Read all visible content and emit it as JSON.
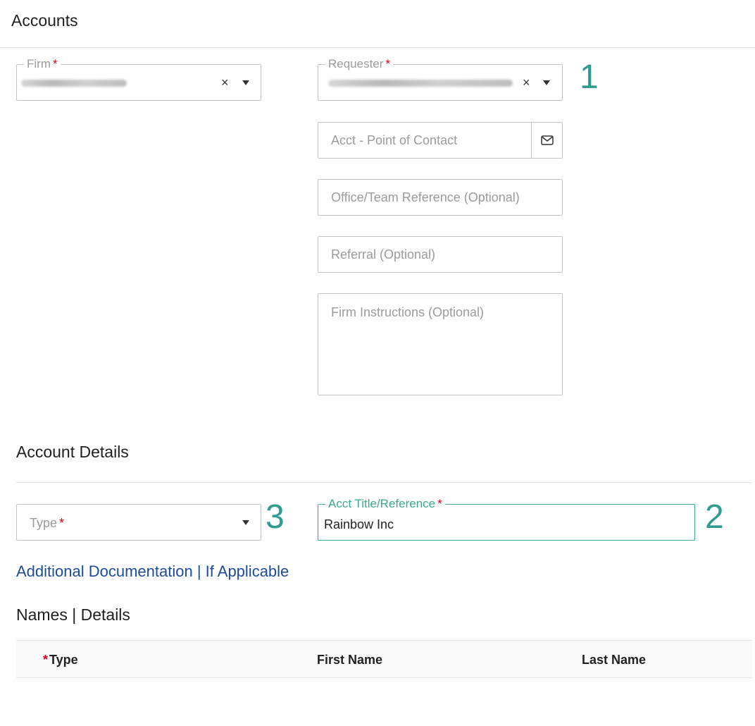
{
  "page": {
    "title": "Accounts"
  },
  "firm": {
    "label": "Firm",
    "required_mark": "*",
    "clear_glyph": "×"
  },
  "requester": {
    "label": "Requester",
    "required_mark": "*",
    "clear_glyph": "×"
  },
  "contact": {
    "placeholder": "Acct - Point of Contact",
    "icon": "envelope-icon"
  },
  "office": {
    "placeholder": "Office/Team Reference (Optional)"
  },
  "referral": {
    "placeholder": "Referral (Optional)"
  },
  "instructions": {
    "placeholder": "Firm Instructions (Optional)"
  },
  "account_details": {
    "title": "Account Details",
    "type": {
      "placeholder": "Type",
      "required_mark": "*"
    },
    "acct_title": {
      "label": "Acct Title/Reference",
      "required_mark": "*",
      "value": "Rainbow Inc"
    },
    "doc_link": "Additional Documentation | If Applicable"
  },
  "annotations": {
    "n1": "1",
    "n2": "2",
    "n3": "3"
  },
  "names": {
    "title": "Names | Details",
    "columns": {
      "type_mark": "*",
      "type": "Type",
      "first": "First Name",
      "last": "Last Name"
    }
  },
  "colors": {
    "accent": "#3aa88f",
    "annotation": "#2e9c8f",
    "link": "#1b4d99",
    "required": "#d0021b"
  }
}
